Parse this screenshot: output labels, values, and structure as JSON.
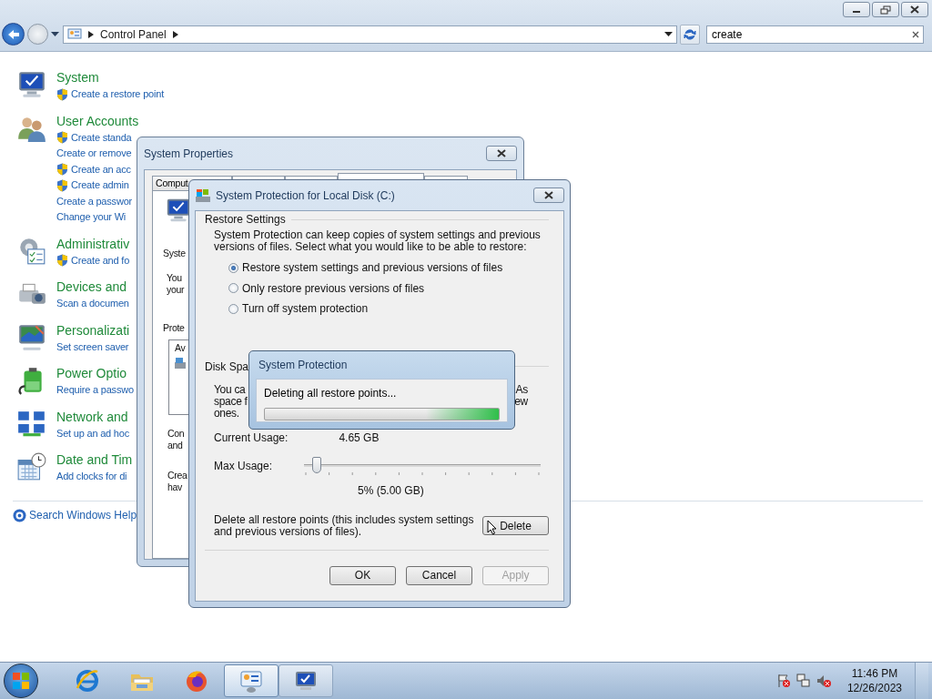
{
  "address_bar": {
    "path": "Control Panel"
  },
  "search": {
    "value": "create"
  },
  "categories": [
    {
      "kind": "system",
      "title": "System",
      "links": [
        {
          "text": "Create a restore point",
          "shield": true
        }
      ]
    },
    {
      "kind": "users",
      "title": "User Accounts",
      "links": [
        {
          "text": "Create standa",
          "shield": true
        },
        {
          "text": "Create or remove",
          "shield": false
        },
        {
          "text": "Create an acc",
          "shield": true
        },
        {
          "text": "Create admin",
          "shield": true
        },
        {
          "text": "Create a passwor",
          "shield": false
        },
        {
          "text": "Change your Wi",
          "shield": false
        }
      ]
    },
    {
      "kind": "admin",
      "title": "Administrativ",
      "links": [
        {
          "text": "Create and fo",
          "shield": true
        }
      ]
    },
    {
      "kind": "devices",
      "title": "Devices and",
      "links": [
        {
          "text": "Scan a documen",
          "shield": false
        }
      ]
    },
    {
      "kind": "personalization",
      "title": "Personalizati",
      "links": [
        {
          "text": "Set screen saver",
          "shield": false
        }
      ]
    },
    {
      "kind": "power",
      "title": "Power Optio",
      "links": [
        {
          "text": "Require a passwo",
          "shield": false
        }
      ]
    },
    {
      "kind": "network",
      "title": "Network and",
      "links": [
        {
          "text": "Set up an ad hoc",
          "shield": false
        }
      ]
    },
    {
      "kind": "clock",
      "title": "Date and Tim",
      "links": [
        {
          "text": "Add clocks for di",
          "shield": false
        }
      ]
    }
  ],
  "help_link": "Search Windows Help",
  "system_properties": {
    "title": "System Properties",
    "tabs": [
      {
        "label": "Comput",
        "selected": false
      },
      {
        "selected": false
      },
      {
        "selected": false
      },
      {
        "selected": true
      },
      {
        "selected": false
      }
    ],
    "heading": "Syste",
    "intro": [
      "You",
      "your"
    ],
    "list_label": "Prote",
    "list_header": "Av",
    "config": [
      "Con",
      "and"
    ],
    "create": [
      "Crea",
      "hav"
    ]
  },
  "protection_dialog": {
    "title": "System Protection for Local Disk (C:)",
    "restore_heading": "Restore Settings",
    "description": "System Protection can keep copies of system settings and previous versions of files. Select what you would like to be able to restore:",
    "options": [
      {
        "label": "Restore system settings and previous versions of files",
        "selected": true
      },
      {
        "label": "Only restore previous versions of files",
        "selected": false
      },
      {
        "label": "Turn off system protection",
        "selected": false
      }
    ],
    "disk_heading": "Disk Spa",
    "disk_lines": [
      {
        "left": "You ca",
        "right": "As"
      },
      {
        "left": "space f",
        "right": "ew"
      },
      {
        "left": "ones."
      }
    ],
    "current_usage_label": "Current Usage:",
    "current_usage": "4.65 GB",
    "max_usage_label": "Max Usage:",
    "max_usage": {
      "level": 0.055
    },
    "max_usage_reading": "5% (5.00 GB)",
    "delete_text": "Delete all restore points (this includes system settings and previous versions of files).",
    "delete_button": "Delete",
    "buttons": [
      {
        "label": "OK",
        "disabled": false
      },
      {
        "label": "Cancel",
        "disabled": false
      },
      {
        "label": "Apply",
        "disabled": true
      }
    ]
  },
  "progress_dialog": {
    "title": "System Protection",
    "message": "Deleting all restore points...",
    "marquee": true
  },
  "taskbar": {
    "items": [
      {
        "kind": "browser",
        "selected": false
      },
      {
        "kind": "folder",
        "selected": false
      },
      {
        "kind": "firefox",
        "selected": false
      },
      {
        "kind": "control_panel",
        "selected": true
      },
      {
        "kind": "system",
        "selected": false
      }
    ],
    "time": "11:46 PM",
    "date": "12/26/2023"
  }
}
